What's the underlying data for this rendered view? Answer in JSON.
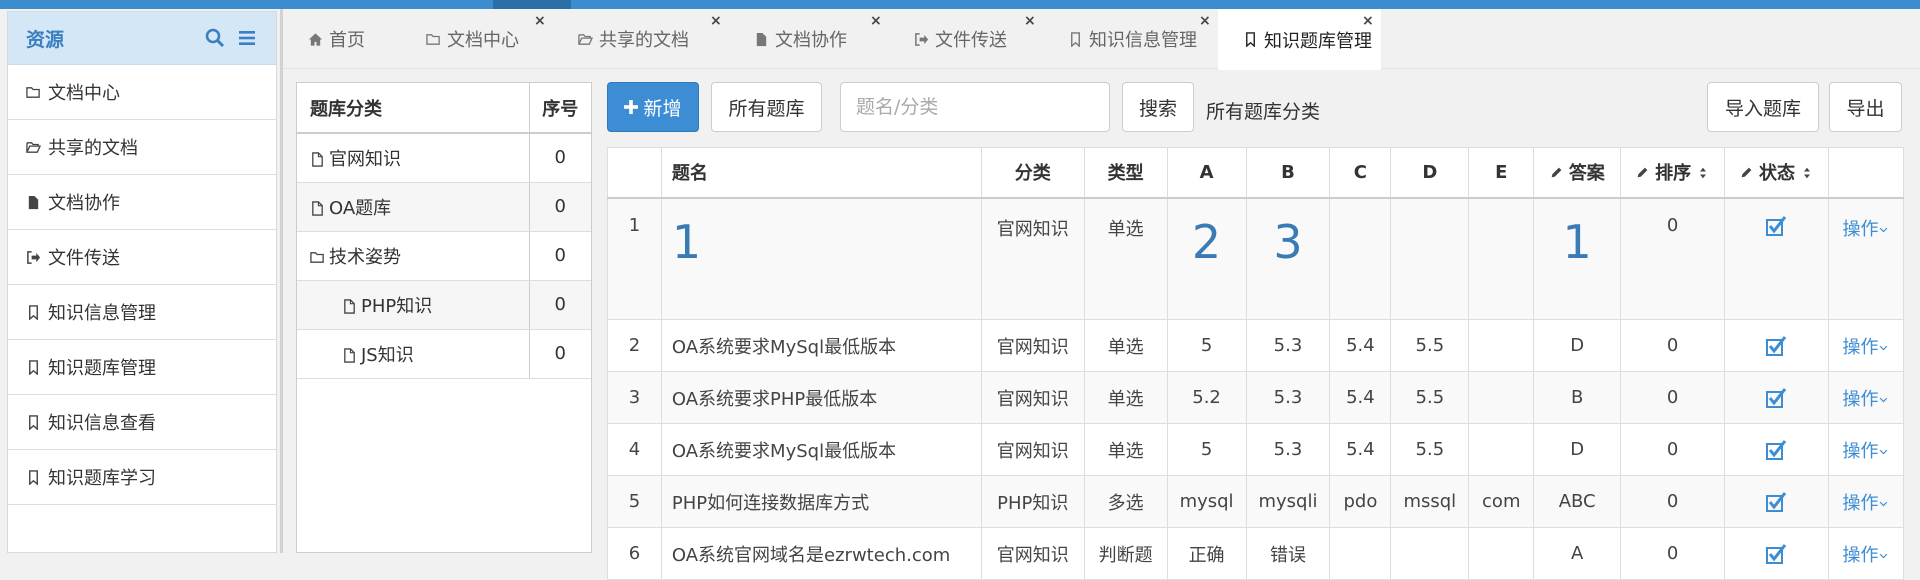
{
  "sidebar": {
    "title": "资源",
    "items": [
      {
        "label": "文档中心",
        "icon": "folder-icon"
      },
      {
        "label": "共享的文档",
        "icon": "folder-open-icon"
      },
      {
        "label": "文档协作",
        "icon": "file-icon"
      },
      {
        "label": "文件传送",
        "icon": "sign-out-icon"
      },
      {
        "label": "知识信息管理",
        "icon": "bookmark-icon"
      },
      {
        "label": "知识题库管理",
        "icon": "bookmark-icon"
      },
      {
        "label": "知识信息查看",
        "icon": "bookmark-icon"
      },
      {
        "label": "知识题库学习",
        "icon": "bookmark-icon"
      }
    ]
  },
  "tabs": [
    {
      "label": "首页",
      "icon": "home-icon",
      "closable": false
    },
    {
      "label": "文档中心",
      "icon": "folder-icon",
      "closable": true
    },
    {
      "label": "共享的文档",
      "icon": "folder-open-icon",
      "closable": true
    },
    {
      "label": "文档协作",
      "icon": "file-icon",
      "closable": true
    },
    {
      "label": "文件传送",
      "icon": "sign-out-icon",
      "closable": true
    },
    {
      "label": "知识信息管理",
      "icon": "bookmark-icon",
      "closable": true
    },
    {
      "label": "知识题库管理",
      "icon": "bookmark-icon",
      "closable": true,
      "active": true
    }
  ],
  "tab_close": "×",
  "category_panel": {
    "headers": [
      "题库分类",
      "序号"
    ],
    "rows": [
      {
        "name": "官网知识",
        "order": "0",
        "icon": "file-icon",
        "indent": 0
      },
      {
        "name": "OA题库",
        "order": "0",
        "icon": "file-icon",
        "indent": 0
      },
      {
        "name": "技术姿势",
        "order": "0",
        "icon": "folder-icon",
        "indent": 0
      },
      {
        "name": "PHP知识",
        "order": "0",
        "icon": "file-icon",
        "indent": 1
      },
      {
        "name": "JS知识",
        "order": "0",
        "icon": "file-icon",
        "indent": 1
      }
    ]
  },
  "toolbar": {
    "add_label": "新增",
    "all_label": "所有题库",
    "search_placeholder": "题名/分类",
    "search_label": "搜索",
    "category_label": "所有题库分类",
    "import_label": "导入题库",
    "export_label": "导出"
  },
  "grid": {
    "headers": [
      "",
      "题名",
      "分类",
      "类型",
      "A",
      "B",
      "C",
      "D",
      "E",
      "答案",
      "排序",
      "状态",
      ""
    ],
    "rows": [
      {
        "no": "1",
        "title": "1",
        "category": "官网知识",
        "type": "单选",
        "a": "2",
        "b": "3",
        "c": "",
        "d": "",
        "e": "",
        "answer": "1",
        "order": "0",
        "checked": true,
        "op": "操作"
      },
      {
        "no": "2",
        "title": "OA系统要求MySql最低版本",
        "category": "官网知识",
        "type": "单选",
        "a": "5",
        "b": "5.3",
        "c": "5.4",
        "d": "5.5",
        "e": "",
        "answer": "D",
        "order": "0",
        "checked": true,
        "op": "操作"
      },
      {
        "no": "3",
        "title": "OA系统要求PHP最低版本",
        "category": "官网知识",
        "type": "单选",
        "a": "5.2",
        "b": "5.3",
        "c": "5.4",
        "d": "5.5",
        "e": "",
        "answer": "B",
        "order": "0",
        "checked": true,
        "op": "操作"
      },
      {
        "no": "4",
        "title": "OA系统要求MySql最低版本",
        "category": "官网知识",
        "type": "单选",
        "a": "5",
        "b": "5.3",
        "c": "5.4",
        "d": "5.5",
        "e": "",
        "answer": "D",
        "order": "0",
        "checked": true,
        "op": "操作"
      },
      {
        "no": "5",
        "title": "PHP如何连接数据库方式",
        "category": "PHP知识",
        "type": "多选",
        "a": "mysql",
        "b": "mysqli",
        "c": "pdo",
        "d": "mssql",
        "e": "com",
        "answer": "ABC",
        "order": "0",
        "checked": true,
        "op": "操作"
      },
      {
        "no": "6",
        "title": "OA系统官网域名是ezrwtech.com",
        "category": "官网知识",
        "type": "判断题",
        "a": "正确",
        "b": "错误",
        "c": "",
        "d": "",
        "e": "",
        "answer": "A",
        "order": "0",
        "checked": true,
        "op": "操作"
      }
    ]
  },
  "colors": {
    "accent": "#3c8dd4",
    "topbar": "#3c8dcf",
    "sidebar_head": "#d4e7f7"
  }
}
